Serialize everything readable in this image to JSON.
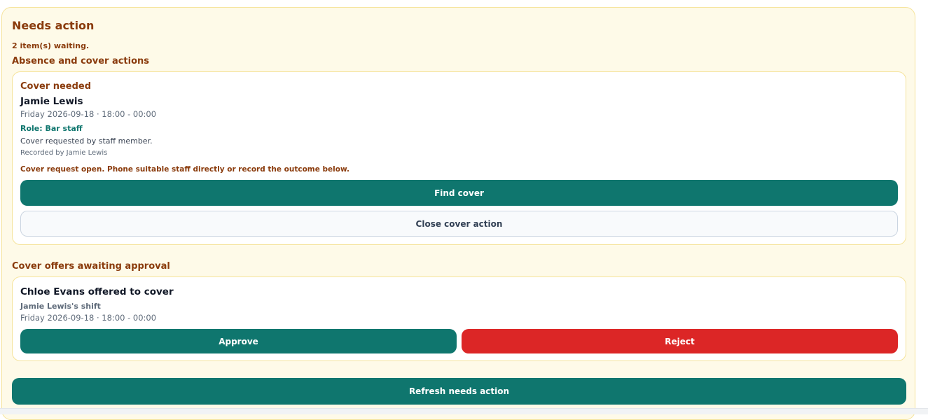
{
  "needs_action": {
    "title": "Needs action",
    "count_text": "2 item(s) waiting."
  },
  "absence_section": {
    "title": "Absence and cover actions",
    "card": {
      "status": "Cover needed",
      "name": "Jamie Lewis",
      "shift": "Friday 2026-09-18 · 18:00 - 00:00",
      "role": "Role: Bar staff",
      "note": "Cover requested by staff member.",
      "recorded_by": "Recorded by Jamie Lewis",
      "message": "Cover request open. Phone suitable staff directly or record the outcome below.",
      "find_cover_label": "Find cover",
      "close_label": "Close cover action"
    }
  },
  "offers_section": {
    "title": "Cover offers awaiting approval",
    "card": {
      "headline": "Chloe Evans offered to cover",
      "shift_owner": "Jamie Lewis's shift",
      "shift": "Friday 2026-09-18 · 18:00 - 00:00",
      "approve_label": "Approve",
      "reject_label": "Reject"
    }
  },
  "refresh_label": "Refresh needs action",
  "colors": {
    "panel_bg": "#fefae8",
    "accent_brown": "#8a3b0c",
    "primary_teal": "#0f766e",
    "danger_red": "#dc2626"
  }
}
